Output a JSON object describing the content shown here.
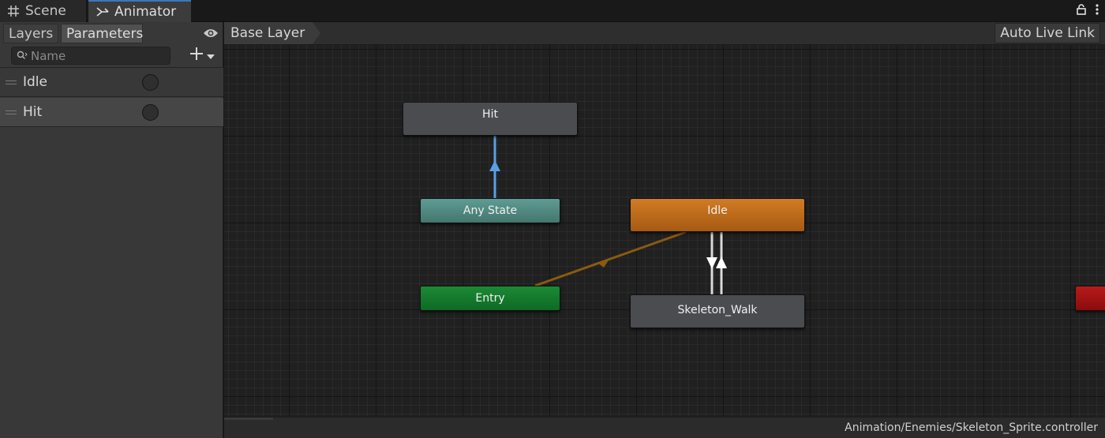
{
  "tabs": {
    "scene_label": "Scene",
    "animator_label": "Animator"
  },
  "left_panel": {
    "tabs": {
      "layers_label": "Layers",
      "parameters_label": "Parameters"
    },
    "search": {
      "placeholder": "Name",
      "value": ""
    },
    "parameters": [
      {
        "name": "Idle",
        "type": "trigger"
      },
      {
        "name": "Hit",
        "type": "trigger"
      }
    ]
  },
  "graph": {
    "breadcrumb": "Base Layer",
    "live_link_label": "Auto Live Link",
    "states": {
      "hit": "Hit",
      "any_state": "Any State",
      "idle": "Idle",
      "entry": "Entry",
      "skeleton_walk": "Skeleton_Walk",
      "exit": ""
    },
    "colors": {
      "default_state": "#4a4c50",
      "any_state": "#5e9c93",
      "default_entry_state": "#d27b24",
      "entry": "#1a8a35",
      "exit": "#b81a1a",
      "selected_transition": "#5a9fe6",
      "entry_transition": "#8a5a10",
      "transition": "#d9d9d9"
    }
  },
  "status": {
    "asset_path": "Animation/Enemies/Skeleton_Sprite.controller"
  }
}
